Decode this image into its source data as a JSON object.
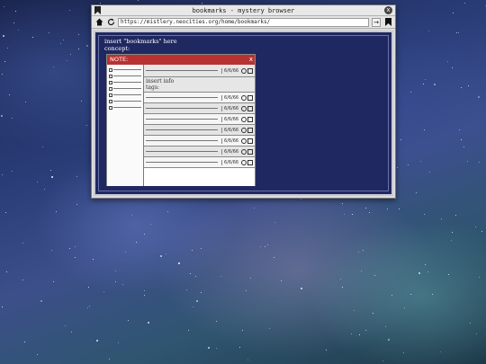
{
  "window": {
    "title": "bookmarks - mystery browser",
    "close_glyph": "x",
    "icons": [
      "bookmark-icon",
      "home-icon",
      "reload-icon",
      "arrow-right-icon",
      "bookmark-icon",
      "close-icon"
    ]
  },
  "toolbar": {
    "url": "https://mistlery.neocities.org/home/bookmarks/",
    "go_glyph": "→",
    "home_glyph": "⌂",
    "reload_glyph": "↻",
    "bookmark_glyph": "▮"
  },
  "page": {
    "line1": "insert \"bookmarks\" here",
    "line2": "concept:"
  },
  "concept": {
    "header_label": "NOTE:",
    "close_glyph": "x",
    "first_date": "6/6/66",
    "info_label": "insert info",
    "tags_label": "tags:",
    "dates": [
      "6/6/66",
      "6/6/66",
      "6/6/66",
      "6/6/66",
      "6/6/66",
      "6/6/66",
      "6/6/66"
    ],
    "sidebar_items": 7
  },
  "colors": {
    "content_bg": "#1f2860",
    "concept_header": "#b83232"
  }
}
